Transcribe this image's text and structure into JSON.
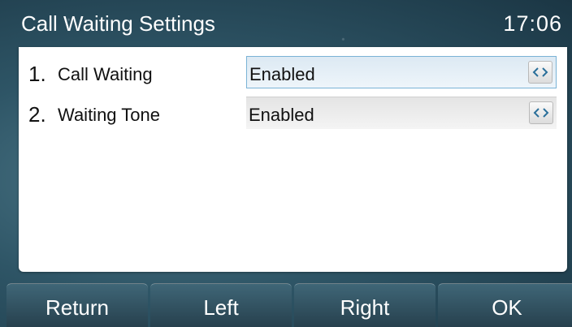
{
  "header": {
    "title": "Call Waiting Settings",
    "time": "17:06"
  },
  "settings": [
    {
      "number": "1.",
      "label": "Call Waiting",
      "value": "Enabled",
      "focused": true
    },
    {
      "number": "2.",
      "label": "Waiting Tone",
      "value": "Enabled",
      "focused": false
    }
  ],
  "icons": {
    "value_switcher": "left-right-arrows-icon"
  },
  "softkeys": [
    "Return",
    "Left",
    "Right",
    "OK"
  ],
  "colors": {
    "focus_border": "#7ab3d6",
    "arrow_icon": "#2a6f9a",
    "background": "#2e5566"
  }
}
